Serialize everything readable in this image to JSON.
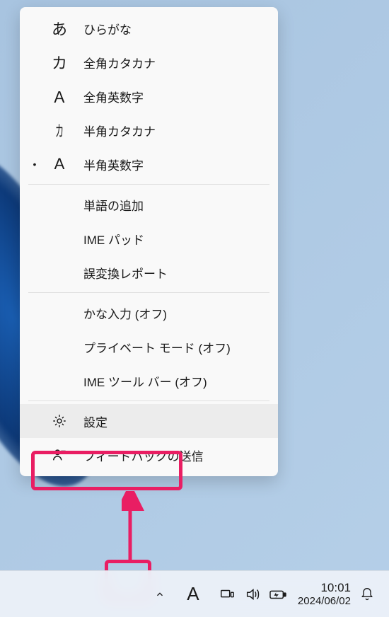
{
  "menu": {
    "modes": [
      {
        "icon": "あ",
        "label": "ひらがな",
        "selected": false
      },
      {
        "icon": "カ",
        "label": "全角カタカナ",
        "selected": false
      },
      {
        "icon": "Ａ",
        "label": "全角英数字",
        "selected": false
      },
      {
        "icon": "カ",
        "label": "半角カタカナ",
        "selected": false,
        "narrow": true
      },
      {
        "icon": "A",
        "label": "半角英数字",
        "selected": true
      }
    ],
    "tools": [
      {
        "label": "単語の追加"
      },
      {
        "label": "IME パッド"
      },
      {
        "label": "誤変換レポート"
      }
    ],
    "toggles": [
      {
        "label": "かな入力 (オフ)"
      },
      {
        "label": "プライベート モード (オフ)"
      },
      {
        "label": "IME ツール バー (オフ)"
      }
    ],
    "footer": [
      {
        "icon": "gear",
        "label": "設定",
        "highlighted": true
      },
      {
        "icon": "feedback",
        "label": "フィードバックの送信"
      }
    ]
  },
  "taskbar": {
    "ime_mode": "A",
    "time": "10:01",
    "date": "2024/06/02"
  }
}
